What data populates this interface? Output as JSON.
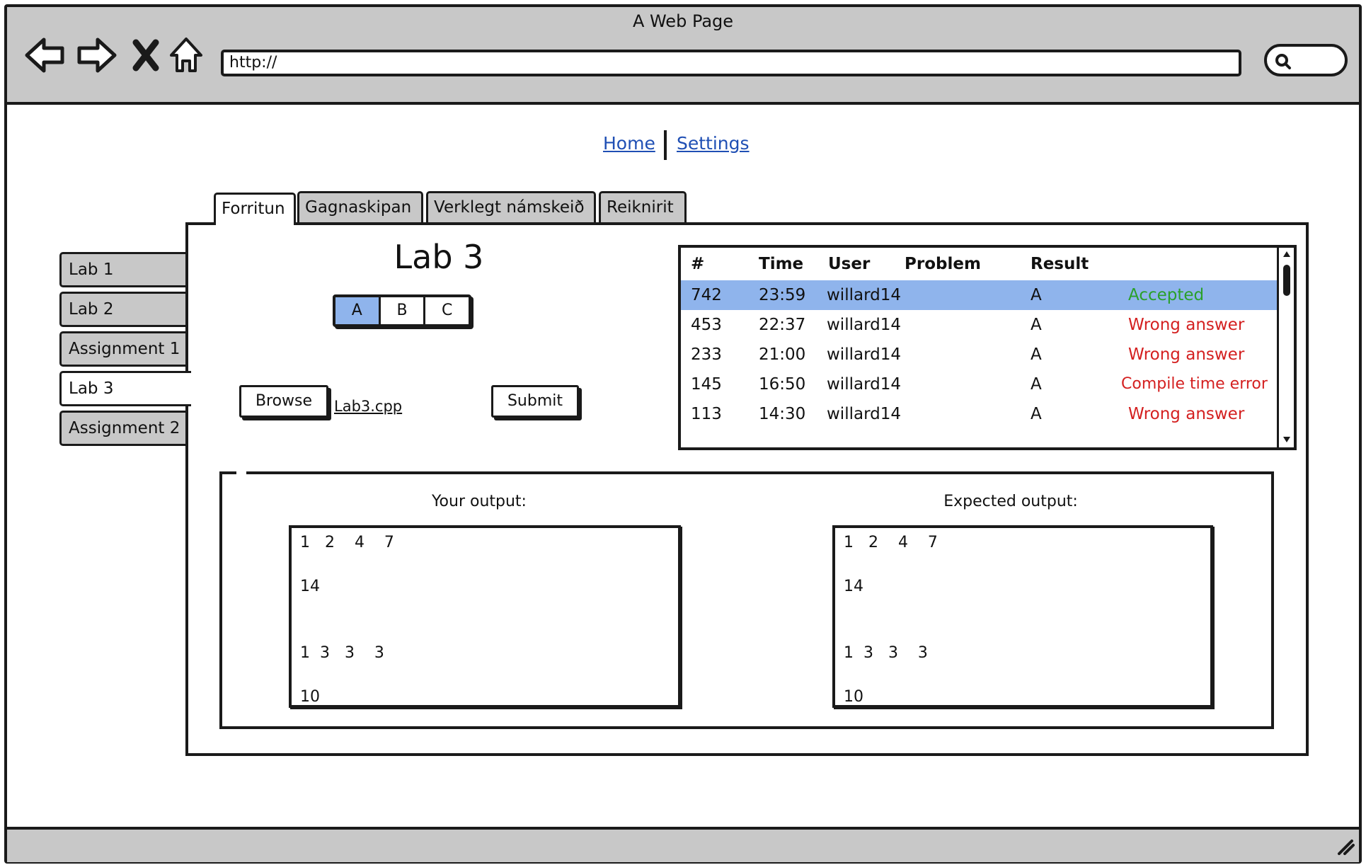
{
  "browser": {
    "window_title": "A Web Page",
    "url": "http://",
    "nav_icons": [
      "back-arrow-icon",
      "forward-arrow-icon",
      "close-x-icon",
      "home-icon",
      "search-icon",
      "resize-grip-icon"
    ]
  },
  "top_nav": {
    "home_label": "Home",
    "settings_label": "Settings"
  },
  "course_tabs": [
    {
      "label": "Forritun",
      "active": true
    },
    {
      "label": "Gagnaskipan",
      "active": false
    },
    {
      "label": "Verklegt námskeið",
      "active": false
    },
    {
      "label": "Reiknirit",
      "active": false
    }
  ],
  "lab_tabs": [
    {
      "label": "Lab 1",
      "active": false
    },
    {
      "label": "Lab 2",
      "active": false
    },
    {
      "label": "Assignment 1",
      "active": false
    },
    {
      "label": "Lab 3",
      "active": true
    },
    {
      "label": "Assignment 2",
      "active": false
    }
  ],
  "lab": {
    "title": "Lab 3",
    "problems": [
      "A",
      "B",
      "C"
    ],
    "selected_problem": "A"
  },
  "upload": {
    "browse_label": "Browse",
    "file_name": "Lab3.cpp",
    "submit_label": "Submit"
  },
  "submissions": {
    "columns": [
      "#",
      "Time",
      "User",
      "Problem",
      "Result"
    ],
    "rows": [
      {
        "id": "742",
        "time": "23:59",
        "user": "willard14",
        "problem": "A",
        "result": "Accepted",
        "selected": true
      },
      {
        "id": "453",
        "time": "22:37",
        "user": "willard14",
        "problem": "A",
        "result": "Wrong answer",
        "selected": false
      },
      {
        "id": "233",
        "time": "21:00",
        "user": "willard14",
        "problem": "A",
        "result": "Wrong answer",
        "selected": false
      },
      {
        "id": "145",
        "time": "16:50",
        "user": "willard14",
        "problem": "A",
        "result": "Compile time error",
        "selected": false
      },
      {
        "id": "113",
        "time": "14:30",
        "user": "willard14",
        "problem": "A",
        "result": "Wrong answer",
        "selected": false
      }
    ]
  },
  "output": {
    "your_label": "Your output:",
    "expected_label": "Expected output:",
    "your_lines": [
      "1   2    4    7",
      "14",
      "1  3   3    3",
      "10"
    ],
    "expected_lines": [
      "1   2    4    7",
      "14",
      "1  3   3    3",
      "10"
    ]
  },
  "colors": {
    "chrome_gray": "#c8c8c8",
    "selection_blue": "#8fb4ec",
    "link_blue": "#1f4fb4",
    "accepted_green": "#2aa02a",
    "error_red": "#d42020"
  }
}
